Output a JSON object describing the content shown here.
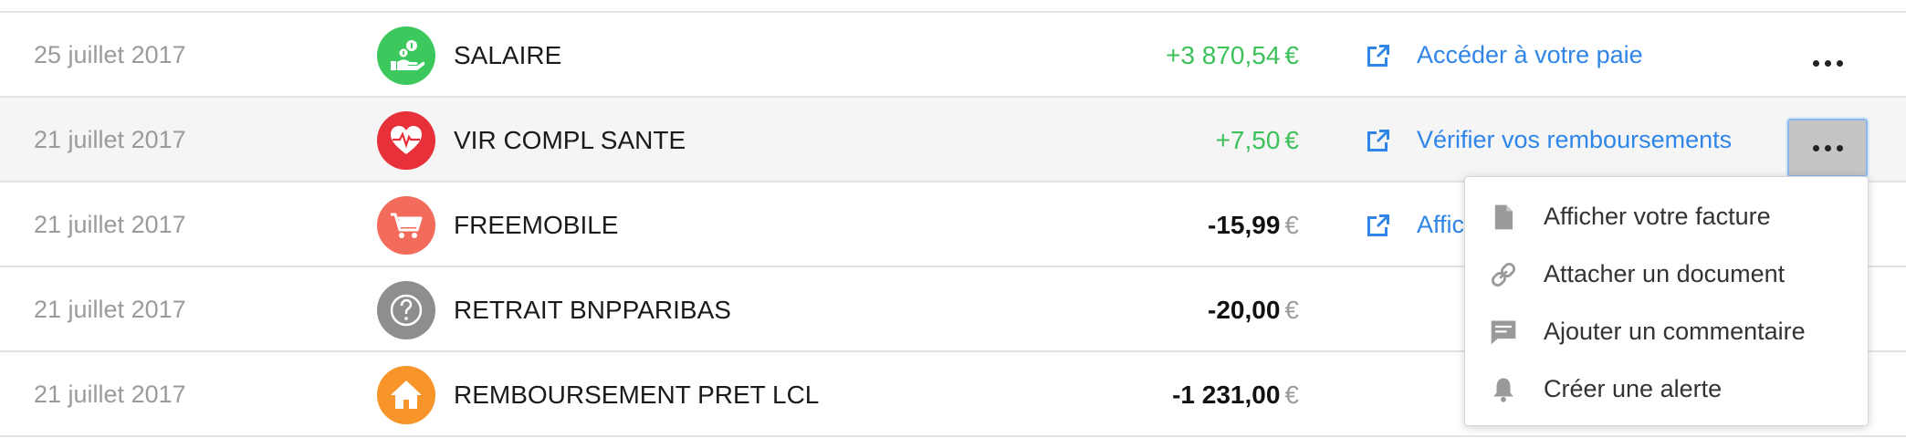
{
  "transactions": [
    {
      "date": "25 juillet 2017",
      "label": "SALAIRE",
      "amount": "+3 870,54",
      "currency": "€",
      "sign": "positive",
      "category_icon": "salary-hand-coins-icon",
      "category_color": "#3cc85c",
      "action": "Accéder à votre paie"
    },
    {
      "date": "21 juillet 2017",
      "label": "VIR COMPL SANTE",
      "amount": "+7,50",
      "currency": "€",
      "sign": "positive",
      "category_icon": "health-heart-icon",
      "category_color": "#e8303a",
      "action": "Vérifier vos remboursements",
      "highlighted": true
    },
    {
      "date": "21 juillet 2017",
      "label": "FREEMOBILE",
      "amount": "-15,99",
      "currency": "€",
      "sign": "negative",
      "category_icon": "shopping-cart-icon",
      "category_color": "#f26b5b",
      "action": "Affic"
    },
    {
      "date": "21 juillet 2017",
      "label": "RETRAIT BNPPARIBAS",
      "amount": "-20,00",
      "currency": "€",
      "sign": "negative",
      "category_icon": "question-mark-icon",
      "category_color": "#8e8e8e",
      "action": ""
    },
    {
      "date": "21 juillet 2017",
      "label": "REMBOURSEMENT PRET LCL",
      "amount": "-1 231,00",
      "currency": "€",
      "sign": "negative",
      "category_icon": "house-icon",
      "category_color": "#f7952a",
      "action": ""
    }
  ],
  "menu": {
    "items": [
      {
        "label": "Afficher votre facture",
        "icon": "document-icon"
      },
      {
        "label": "Attacher un document",
        "icon": "link-icon"
      },
      {
        "label": "Ajouter un commentaire",
        "icon": "comment-icon"
      },
      {
        "label": "Créer une alerte",
        "icon": "bell-icon"
      }
    ]
  },
  "colors": {
    "positive": "#3cc15b",
    "link": "#2f85e8",
    "date": "#9b9b9b"
  }
}
